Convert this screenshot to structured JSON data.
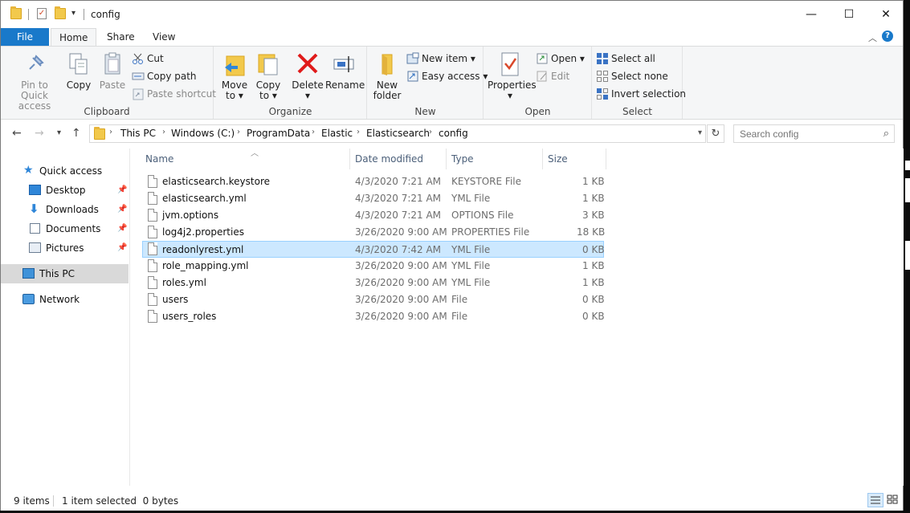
{
  "window": {
    "title": "config",
    "controls": {
      "minimize": "—",
      "maximize": "☐",
      "close": "✕"
    }
  },
  "ribbon_tabs": [
    {
      "label": "File"
    },
    {
      "label": "Home"
    },
    {
      "label": "Share"
    },
    {
      "label": "View"
    }
  ],
  "ribbon": {
    "clipboard": {
      "label": "Clipboard",
      "pin_line1": "Pin to Quick",
      "pin_line2": "access",
      "copy": "Copy",
      "paste": "Paste",
      "cut": "Cut",
      "copy_path": "Copy path",
      "paste_shortcut": "Paste shortcut"
    },
    "organize": {
      "label": "Organize",
      "move_to": "Move",
      "move_to2": "to ▾",
      "copy_to": "Copy",
      "copy_to2": "to ▾",
      "delete": "Delete",
      "delete2": "▾",
      "rename": "Rename"
    },
    "new": {
      "label": "New",
      "new_folder": "New",
      "new_folder2": "folder",
      "new_item": "New item ▾",
      "easy_access": "Easy access ▾"
    },
    "open": {
      "label": "Open",
      "properties": "Properties",
      "properties2": "▾",
      "open": "Open ▾",
      "edit": "Edit"
    },
    "select": {
      "label": "Select",
      "select_all": "Select all",
      "select_none": "Select none",
      "invert": "Invert selection"
    }
  },
  "address": {
    "crumbs": [
      "This PC",
      "Windows (C:)",
      "ProgramData",
      "Elastic",
      "Elasticsearch",
      "config"
    ],
    "search_placeholder": "Search config"
  },
  "nav": [
    {
      "label": "Quick access",
      "icon": "star-icon"
    },
    {
      "label": "Desktop",
      "icon": "desktop-icon",
      "pinned": true
    },
    {
      "label": "Downloads",
      "icon": "download-icon",
      "pinned": true
    },
    {
      "label": "Documents",
      "icon": "documents-icon",
      "pinned": true
    },
    {
      "label": "Pictures",
      "icon": "pictures-icon",
      "pinned": true
    },
    {
      "label": "This PC",
      "icon": "computer-icon",
      "selected": true
    },
    {
      "label": "Network",
      "icon": "network-icon"
    }
  ],
  "columns": {
    "name": "Name",
    "date": "Date modified",
    "type": "Type",
    "size": "Size"
  },
  "files": [
    {
      "name": "elasticsearch.keystore",
      "date": "4/3/2020 7:21 AM",
      "type": "KEYSTORE File",
      "size": "1 KB"
    },
    {
      "name": "elasticsearch.yml",
      "date": "4/3/2020 7:21 AM",
      "type": "YML File",
      "size": "1 KB"
    },
    {
      "name": "jvm.options",
      "date": "4/3/2020 7:21 AM",
      "type": "OPTIONS File",
      "size": "3 KB"
    },
    {
      "name": "log4j2.properties",
      "date": "3/26/2020 9:00 AM",
      "type": "PROPERTIES File",
      "size": "18 KB"
    },
    {
      "name": "readonlyrest.yml",
      "date": "4/3/2020 7:42 AM",
      "type": "YML File",
      "size": "0 KB",
      "selected": true
    },
    {
      "name": "role_mapping.yml",
      "date": "3/26/2020 9:00 AM",
      "type": "YML File",
      "size": "1 KB"
    },
    {
      "name": "roles.yml",
      "date": "3/26/2020 9:00 AM",
      "type": "YML File",
      "size": "1 KB"
    },
    {
      "name": "users",
      "date": "3/26/2020 9:00 AM",
      "type": "File",
      "size": "0 KB"
    },
    {
      "name": "users_roles",
      "date": "3/26/2020 9:00 AM",
      "type": "File",
      "size": "0 KB"
    }
  ],
  "status": {
    "items": "9 items",
    "selection": "1 item selected  0 bytes"
  },
  "colors": {
    "accent": "#1979ca",
    "selection_bg": "#cce8ff",
    "selection_border": "#99d1ff",
    "folder": "#f2c94c"
  }
}
